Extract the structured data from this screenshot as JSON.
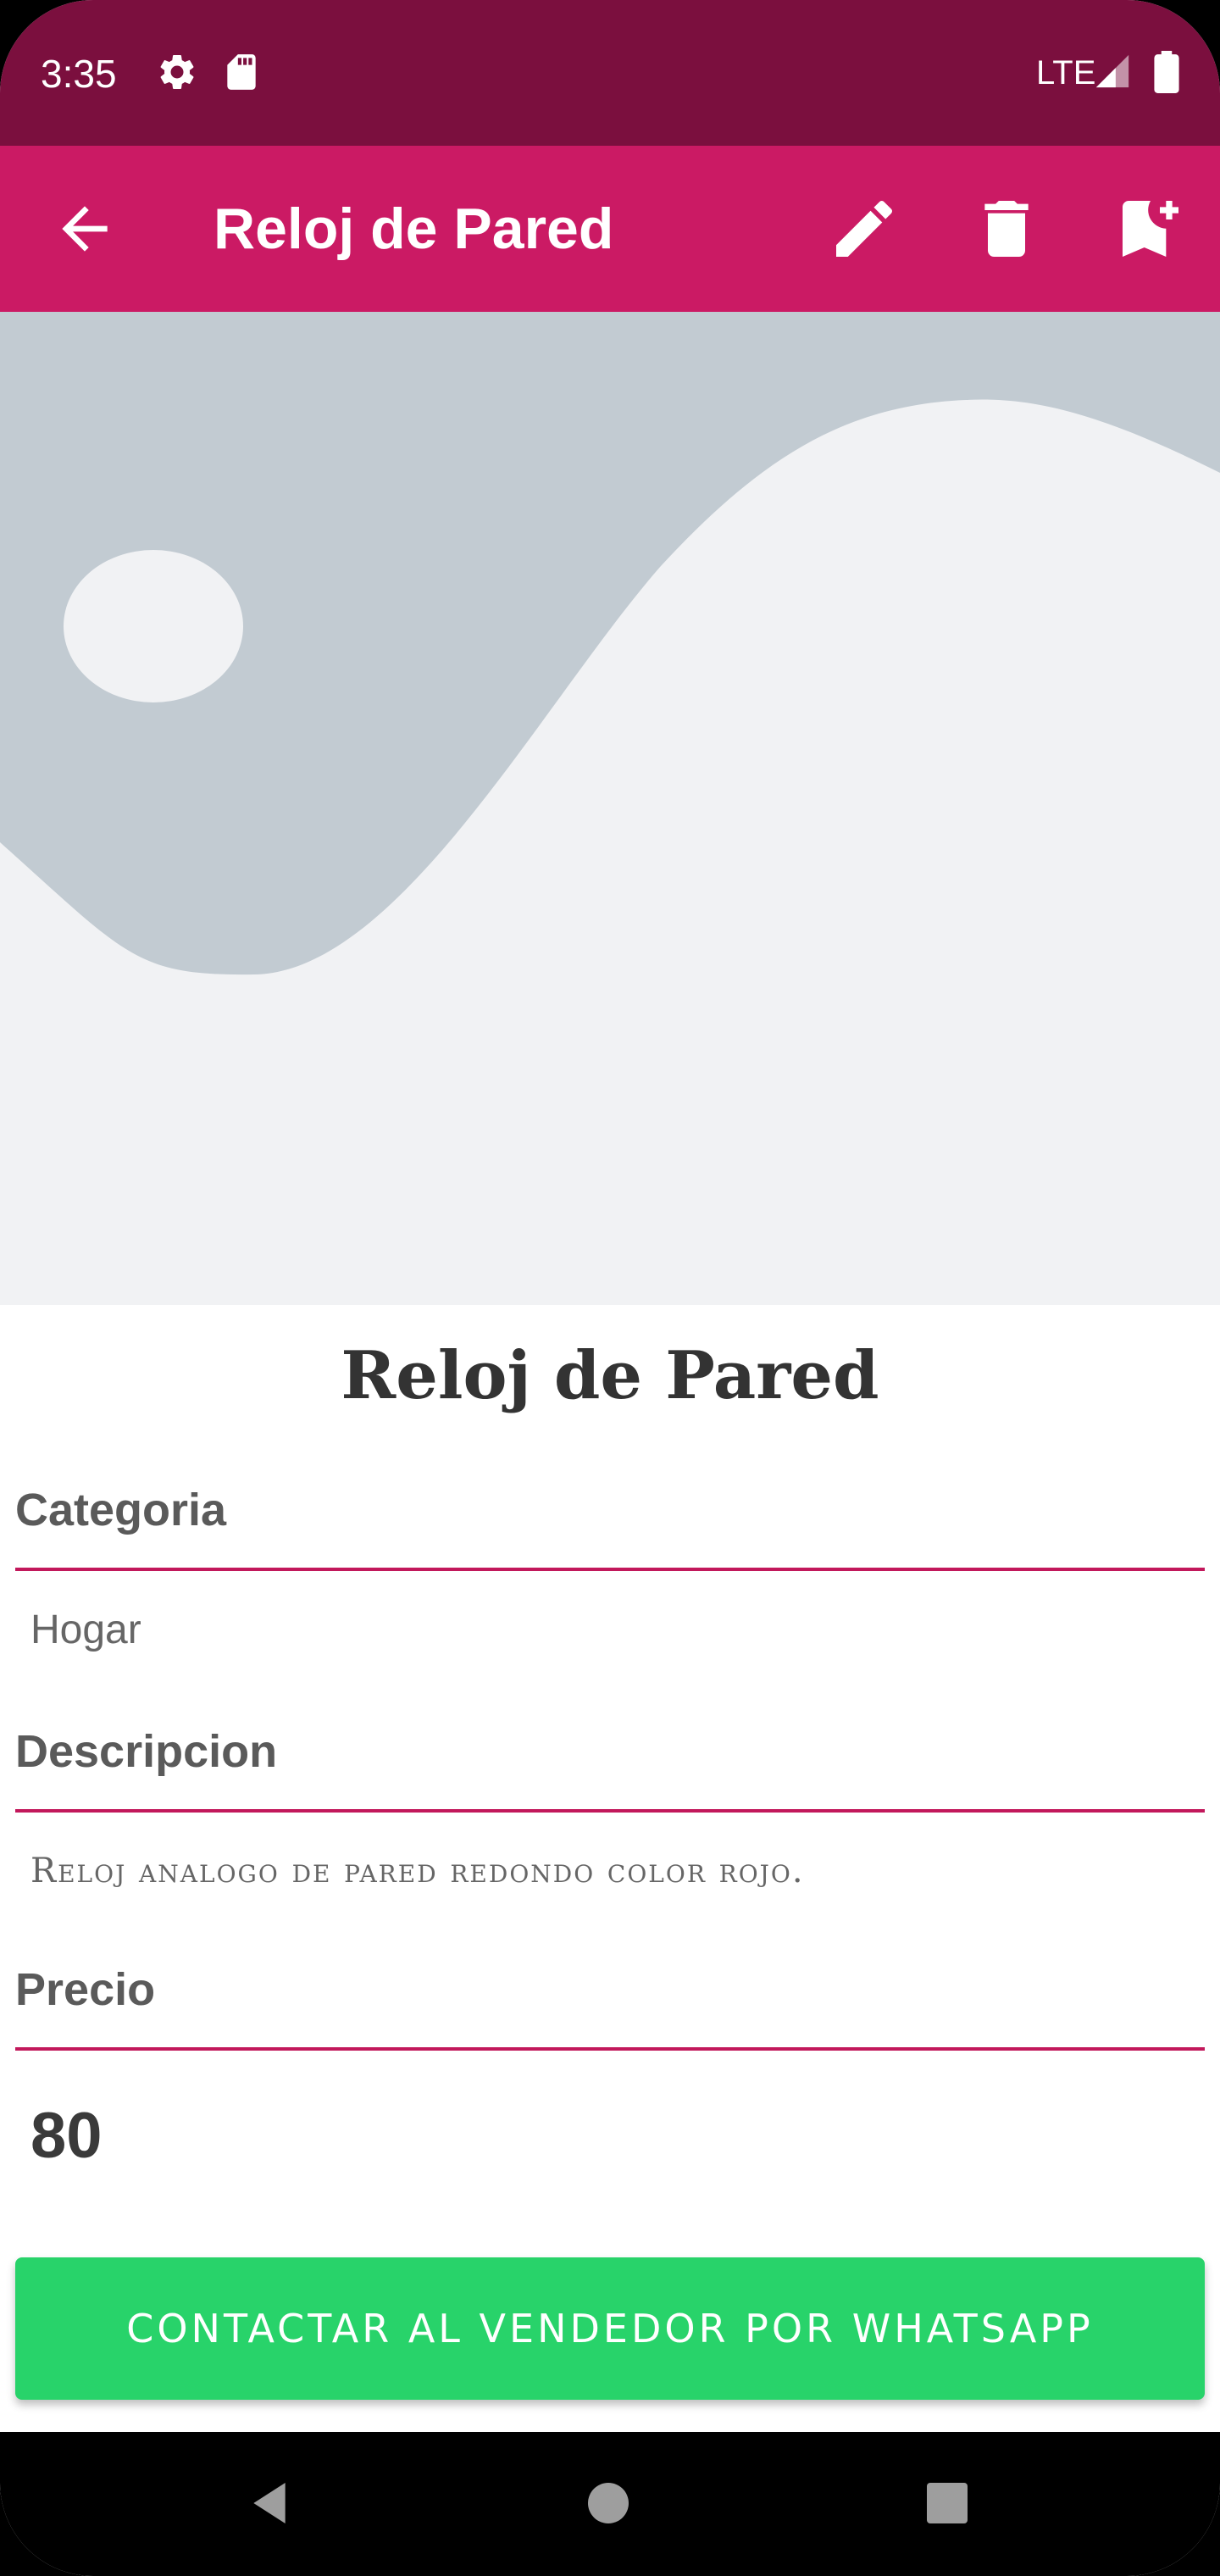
{
  "status_bar": {
    "time": "3:35",
    "network": "LTE",
    "icons": [
      "gear-icon",
      "sd-card-icon",
      "signal-icon",
      "battery-icon"
    ]
  },
  "app_bar": {
    "title": "Reloj de Pared",
    "actions": [
      "edit-icon",
      "delete-icon",
      "bookmark-add-icon"
    ],
    "color": "#cb1a64"
  },
  "product": {
    "title": "Reloj de Pared",
    "fields": [
      {
        "label": "Categoria",
        "value": "Hogar"
      },
      {
        "label": "Descripcion",
        "value": "Reloj analogo de pared redondo color rojo."
      },
      {
        "label": "Precio",
        "value": "80"
      }
    ]
  },
  "contact_button": {
    "label": "CONTACTAR AL VENDEDOR POR WHATSAPP",
    "color": "#28d36a"
  },
  "colors": {
    "status_bar": "#7b0f3e",
    "divider": "#c2185b"
  }
}
